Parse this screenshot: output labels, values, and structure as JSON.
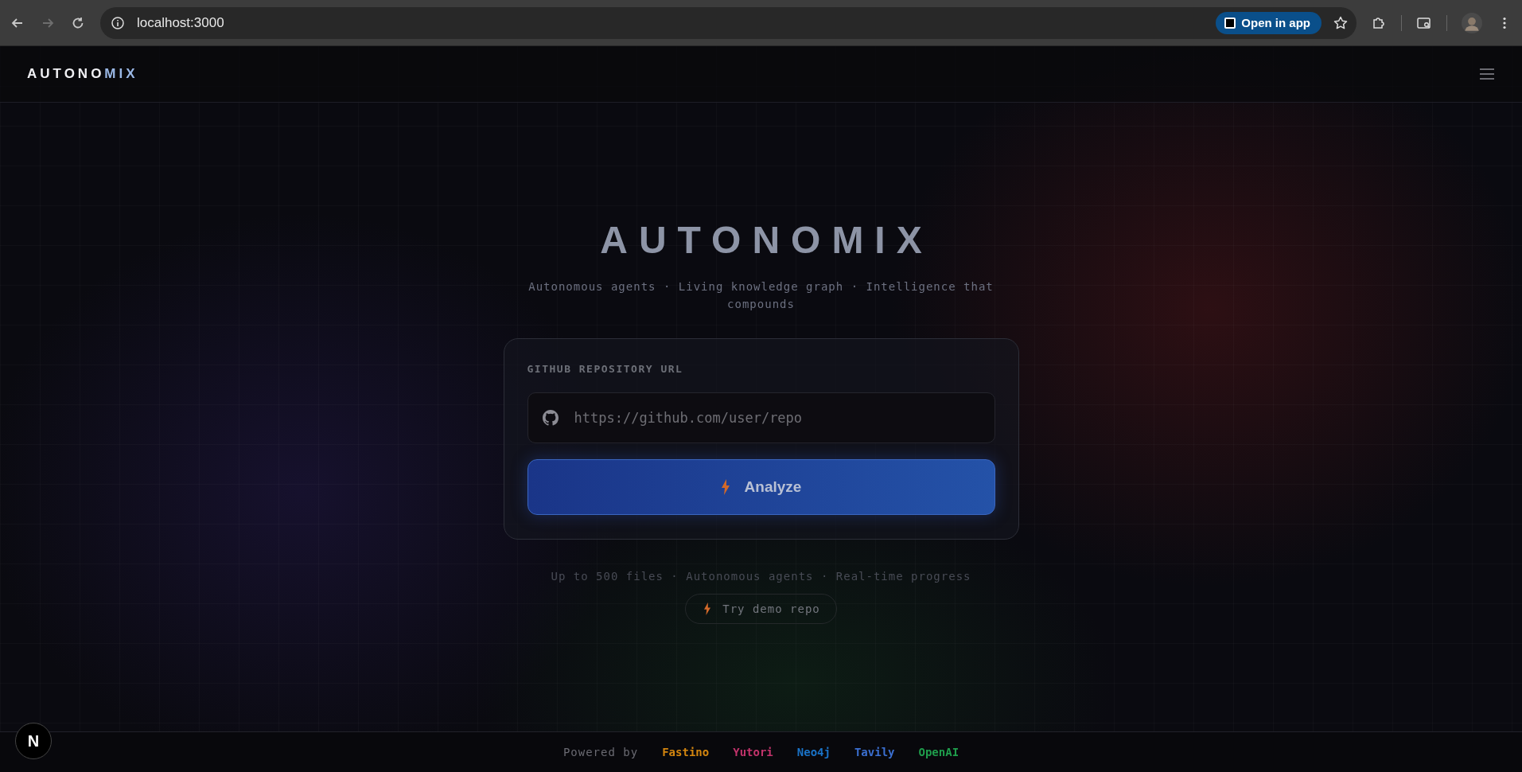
{
  "browser": {
    "url": "localhost:3000",
    "open_in_app": "Open in app",
    "forward_disabled": true
  },
  "header": {
    "logo_main": "AUTONO",
    "logo_accent": "MIX"
  },
  "hero": {
    "title": "AUTONOMIX",
    "subtitle": "Autonomous agents · Living knowledge graph · Intelligence that compounds"
  },
  "form": {
    "label": "GITHUB REPOSITORY URL",
    "placeholder": "https://github.com/user/repo",
    "button": "Analyze"
  },
  "features": "Up to 500 files · Autonomous agents · Real-time progress",
  "demo_button": "Try demo repo",
  "dev_badge": "N",
  "footer": {
    "prefix": "Powered by",
    "partners": [
      {
        "name": "Fastino",
        "color": "#d4860f"
      },
      {
        "name": "Yutori",
        "color": "#c2336b"
      },
      {
        "name": "Neo4j",
        "color": "#1a73c8"
      },
      {
        "name": "Tavily",
        "color": "#3b6fd1"
      },
      {
        "name": "OpenAI",
        "color": "#1f9d4c"
      }
    ]
  }
}
